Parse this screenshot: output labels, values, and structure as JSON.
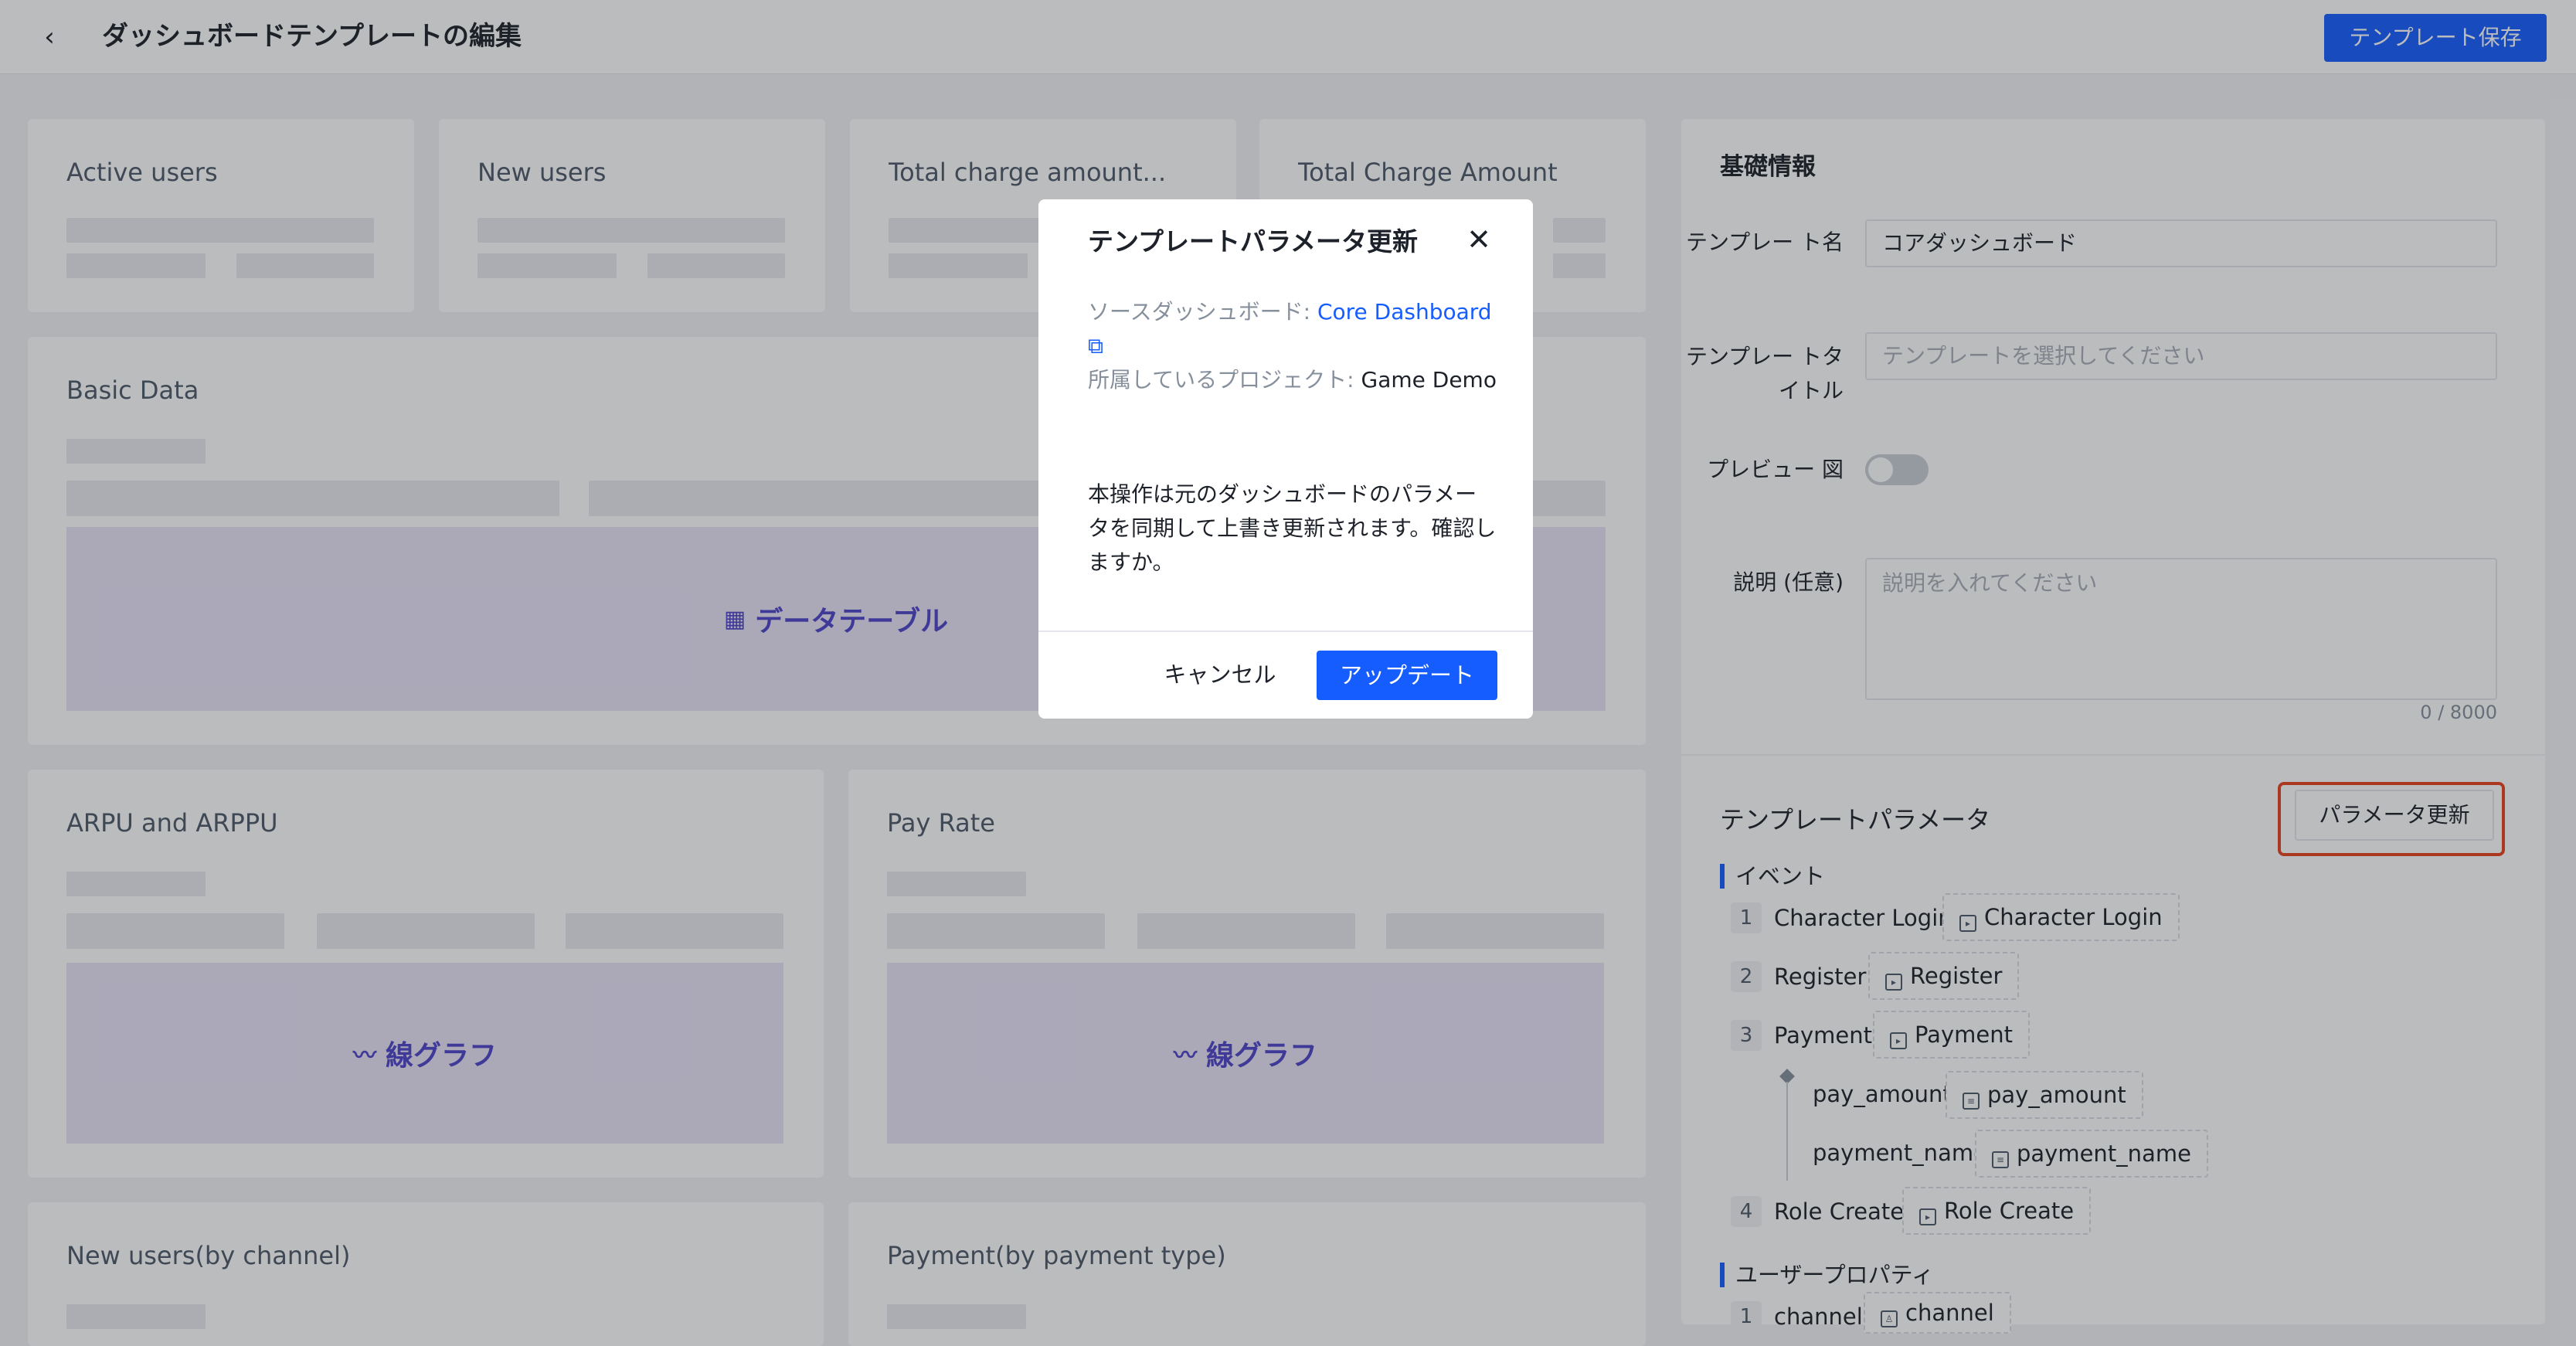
{
  "header": {
    "back_icon": "chevron-left-icon",
    "title": "ダッシュボードテンプレートの編集",
    "save_label": "テンプレート保存"
  },
  "cards": {
    "active_users": "Active users",
    "new_users": "New users",
    "total_charge_amount_lower": "Total charge amount...",
    "total_charge_amount": "Total Charge Amount",
    "basic_data": "Basic Data",
    "basic_data_placeholder": "データテーブル",
    "arpu": "ARPU and ARPPU",
    "arpu_placeholder": "線グラフ",
    "pay_rate": "Pay Rate",
    "pay_rate_placeholder": "線グラフ",
    "new_users_channel": "New users(by channel)",
    "payment_type": "Payment(by payment type)"
  },
  "basic_info": {
    "title": "基礎情報",
    "name_label": "テンプレー ト名",
    "name_value": "コアダッシュボード",
    "title_label": "テンプレー トタイトル",
    "title_placeholder": "テンプレートを選択してください",
    "preview_label": "プレビュー 図",
    "preview_on": false,
    "desc_label": "説明 (任意)",
    "desc_placeholder": "説明を入れてください",
    "desc_counter": "0 / 8000"
  },
  "params": {
    "title": "テンプレートパラメータ",
    "update_button": "パラメータ更新",
    "events_group": "イベント",
    "events": [
      {
        "num": "1",
        "name": "Character Login",
        "tag": "Character Login"
      },
      {
        "num": "2",
        "name": "Register",
        "tag": "Register"
      },
      {
        "num": "3",
        "name": "Payment",
        "tag": "Payment"
      },
      {
        "num": "4",
        "name": "Role Create",
        "tag": "Role Create"
      }
    ],
    "payment_props": [
      {
        "name": "pay_amount",
        "tag": "pay_amount"
      },
      {
        "name": "payment_name",
        "tag": "payment_name"
      }
    ],
    "user_props_group": "ユーザープロパティ",
    "user_props": [
      {
        "num": "1",
        "name": "channel",
        "tag": "channel"
      }
    ]
  },
  "modal": {
    "title": "テンプレートパラメータ更新",
    "source_label": "ソースダッシュボード: ",
    "source_link": "Core Dashboard",
    "project_label": "所属しているプロジェクト: ",
    "project_value": "Game Demo",
    "message": "本操作は元のダッシュボードのパラメータを同期して上書き更新されます。確認しますか。",
    "cancel": "キャンセル",
    "confirm": "アップデート"
  },
  "colors": {
    "primary": "#165dff",
    "highlight": "#e8421f",
    "placeholder_purple": "#4e44c8"
  }
}
